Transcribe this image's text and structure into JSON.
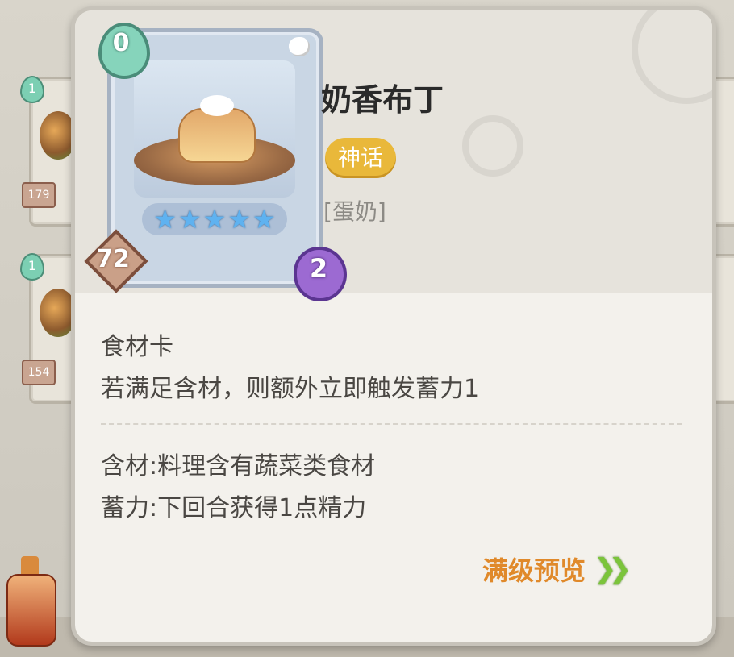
{
  "background_cards": [
    {
      "cost": "1",
      "value": "179"
    },
    {
      "cost": "1",
      "value": "154"
    }
  ],
  "item": {
    "name": "奶香布丁",
    "rarity": "神话",
    "category": "[蛋奶]",
    "cost": "0",
    "stars": 5,
    "hp": "72",
    "energy": "2",
    "type_label": "食材卡",
    "effect": "若满足含材，则额外立即触发蓄力1",
    "keywords": [
      "含材:料理含有蔬菜类食材",
      "蓄力:下回合获得1点精力"
    ],
    "preview_label": "满级预览"
  },
  "colors": {
    "rarity_badge": "#e9b83a",
    "preview_text": "#e0892a",
    "preview_arrow": "#7bc43b",
    "star": "#5fb2f0",
    "cost_drop": "#86d4bb",
    "energy_blob": "#9c6ad2"
  },
  "icons": {
    "cost": "water-drop-icon",
    "energy": "energy-blob-icon",
    "hp": "diamond-icon",
    "star": "star-icon",
    "preview": "double-chevron-right-icon"
  }
}
